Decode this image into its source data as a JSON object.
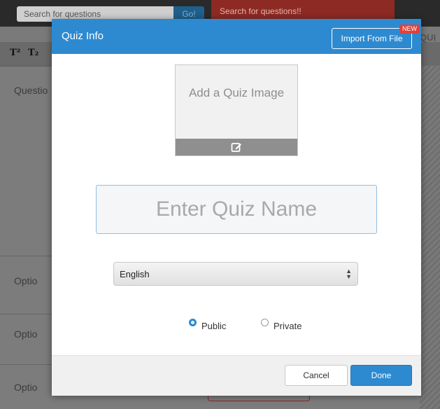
{
  "background": {
    "search_placeholder": "Search for questions",
    "search_go": "Go!",
    "banner_text": "Search for questions!!",
    "right_text": "QUI",
    "toolbar": {
      "superscript": "T²",
      "subscript": "T₂"
    },
    "question_label": "Questio",
    "option_labels": [
      "Optio",
      "Optio",
      "Optio"
    ]
  },
  "modal": {
    "title": "Quiz Info",
    "import_button": "Import From File",
    "new_badge": "NEW",
    "image_placeholder": "Add a Quiz Image",
    "edit_icon": "edit-icon",
    "name_placeholder": "Enter Quiz Name",
    "name_value": "",
    "language": {
      "selected": "English"
    },
    "visibility": {
      "public": "Public",
      "private": "Private",
      "selected": "Public"
    },
    "cancel_button": "Cancel",
    "done_button": "Done"
  },
  "colors": {
    "accent": "#2e8ad0",
    "badge": "#e0413a",
    "overlay": "#7a7a7a"
  }
}
